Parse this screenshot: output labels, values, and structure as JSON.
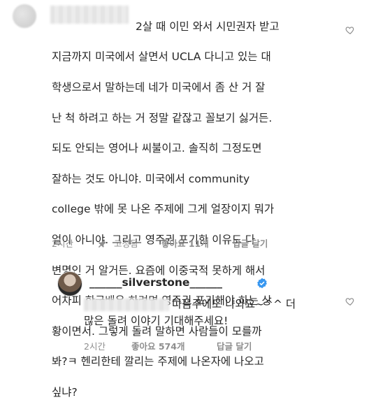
{
  "comment": {
    "lines": [
      "2살 때 이민 와서 시민권자 받고",
      "지금까지 미국에서 살면서 UCLA 다니고 있는 대",
      "학생으로서 말하는데 네가 미국에서 좀 산 거 잘",
      "난 척 하려고 하는 거 정말 같잖고 꼴보기 싫거든.",
      "되도 안되는 영어나 씨불이고. 솔직히 그정도면",
      "잘하는 것도 아니야. 미국에서 community",
      "college 밖에 못 나온 주제에 그게 얼장이지 뭐가",
      "얼이 아니야. 그리고 영주권 포기한 이유도 다",
      "변명인 거 알거든. 요즘에 이중국적 못하게 해서",
      "어차피 한국배우 하려면 영주권 포기해야 하는 상",
      "황이면서. 그렇게 돌려 말하면 사람들이 모를까",
      "봐?ㅋ 헨리한테 깔리는 주제에 나온자에 나오고",
      "싶냐?"
    ],
    "time": "2시간",
    "pinned_label": "고정됨",
    "likes_label": "좋아요 11개",
    "reply_label": "답글 달기"
  },
  "reply": {
    "username": "______silverstone______",
    "lines": [
      "다음주에도 나와요~^^ 더",
      "많은 돌려 이야기 기대해주세요!"
    ],
    "time": "2시간",
    "likes_label": "좋아요 574개",
    "reply_label": "답글 달기"
  },
  "colors": {
    "text": "#262626",
    "meta": "#8e8e8e",
    "verified": "#3897f0"
  },
  "icons": [
    "heart-icon",
    "pin-icon",
    "verified-badge-icon"
  ]
}
